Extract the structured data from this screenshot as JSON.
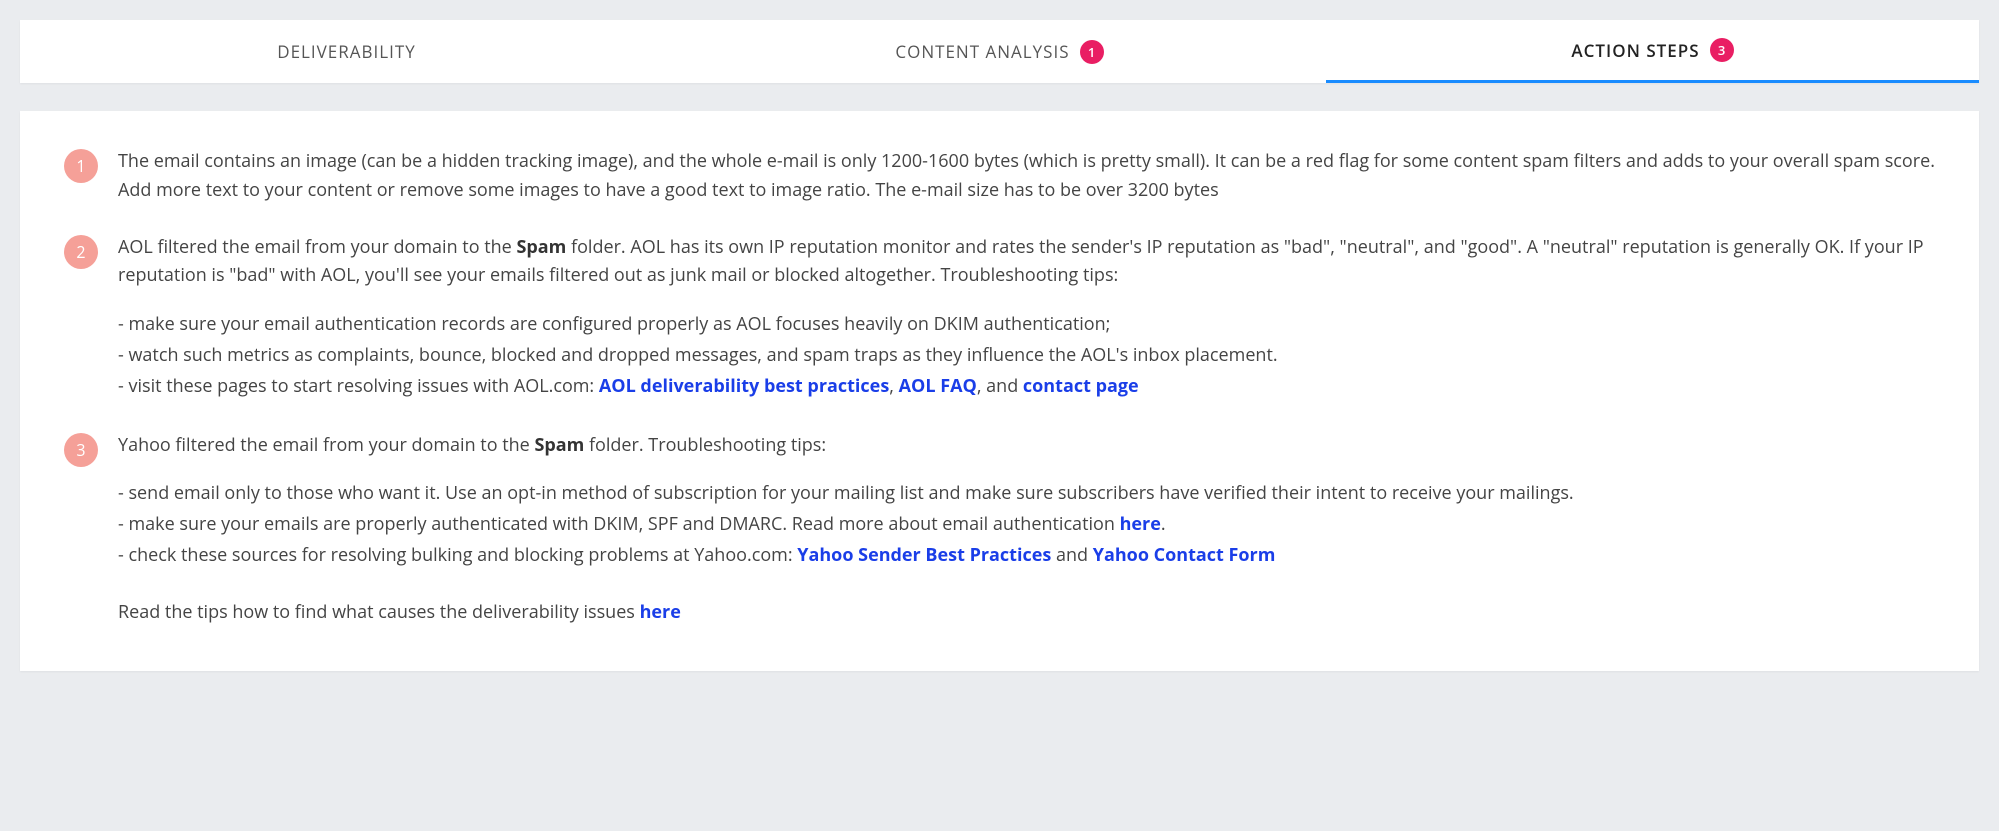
{
  "tabs": [
    {
      "label": "DELIVERABILITY",
      "badge": null,
      "active": false
    },
    {
      "label": "CONTENT ANALYSIS",
      "badge": "1",
      "active": false
    },
    {
      "label": "ACTION STEPS",
      "badge": "3",
      "active": true
    }
  ],
  "steps": [
    {
      "number": "1",
      "intro_parts": [
        {
          "text": "The email contains an image (can be a hidden tracking image), and the whole e-mail is only 1200-1600 bytes (which is pretty small). It can be a red flag for some content spam filters and adds to your overall spam score. Add more text to your content or remove some images to have a good text to image ratio. The e-mail size has to be over 3200 bytes"
        }
      ],
      "sub": []
    },
    {
      "number": "2",
      "intro_parts": [
        {
          "text": "AOL filtered the email from your domain to the "
        },
        {
          "text": "Spam",
          "bold": true
        },
        {
          "text": " folder. AOL has its own IP reputation monitor and rates the sender's IP reputation as \"bad\", \"neutral\", and \"good\". A \"neutral\" reputation is generally OK. If your IP reputation is \"bad\" with AOL, you'll see your emails filtered out as junk mail or blocked altogether. Troubleshooting tips:"
        }
      ],
      "sub": [
        [
          {
            "text": "- make sure your email authentication records are configured properly as AOL focuses heavily on DKIM authentication;"
          }
        ],
        [
          {
            "text": "- watch such metrics as complaints, bounce, blocked and dropped messages, and spam traps as they influence the AOL's inbox placement."
          }
        ],
        [
          {
            "text": "- visit these pages to start resolving issues with AOL.com: "
          },
          {
            "text": "AOL deliverability best practices",
            "link": true
          },
          {
            "text": ", "
          },
          {
            "text": "AOL FAQ",
            "link": true
          },
          {
            "text": ", and "
          },
          {
            "text": "contact page",
            "link": true
          }
        ]
      ]
    },
    {
      "number": "3",
      "intro_parts": [
        {
          "text": "Yahoo filtered the email from your domain to the "
        },
        {
          "text": "Spam",
          "bold": true
        },
        {
          "text": " folder. Troubleshooting tips:"
        }
      ],
      "sub": [
        [
          {
            "text": "- send email only to those who want it. Use an opt-in method of subscription for your mailing list and make sure subscribers have verified their intent to receive your mailings."
          }
        ],
        [
          {
            "text": "- make sure your emails are properly authenticated with DKIM, SPF and DMARC. Read more about email authentication "
          },
          {
            "text": "here",
            "link": true
          },
          {
            "text": "."
          }
        ],
        [
          {
            "text": "- check these sources for resolving bulking and blocking problems at Yahoo.com: "
          },
          {
            "text": "Yahoo Sender Best Practices",
            "link": true
          },
          {
            "text": " and "
          },
          {
            "text": "Yahoo Contact Form",
            "link": true
          }
        ]
      ]
    }
  ],
  "footer_parts": [
    {
      "text": "Read the tips how to find what causes the deliverability issues "
    },
    {
      "text": "here",
      "link": true
    }
  ]
}
